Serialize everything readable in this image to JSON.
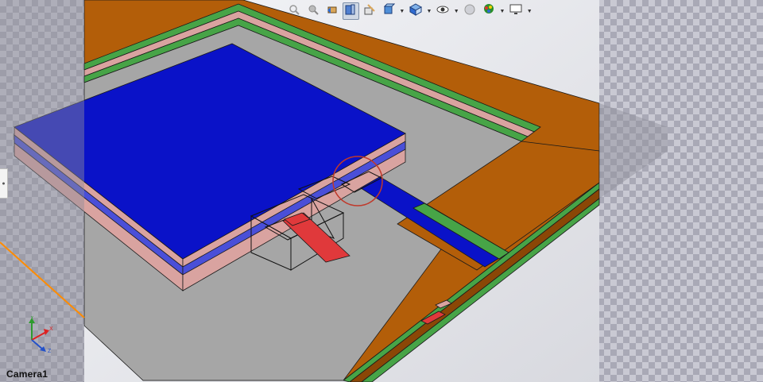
{
  "viewport": {
    "camera_label": "Camera1",
    "colors": {
      "board": "#b35e09",
      "board_edge": "#8a4706",
      "cavity_floor": "#a6a6a6",
      "blue": "#0a12c8",
      "blue_side": "#4a4fd8",
      "green": "#47a447",
      "pink": "#d9a3a0",
      "red": "#e0393b",
      "light_bg": "#e9eaee"
    }
  },
  "toolbar": {
    "items": [
      {
        "name": "zoom-to-fit-icon",
        "active": false
      },
      {
        "name": "zoom-to-area-icon",
        "active": false
      },
      {
        "name": "previous-view-icon",
        "active": false
      },
      {
        "name": "section-view-icon",
        "active": true
      },
      {
        "name": "dynamic-annotation-icon",
        "active": false
      },
      {
        "name": "view-orientation-icon",
        "active": false,
        "dropdown": true
      },
      {
        "name": "display-style-icon",
        "active": false,
        "dropdown": true
      },
      {
        "name": "hide-show-items-icon",
        "active": false,
        "dropdown": true
      },
      {
        "name": "edit-appearance-icon",
        "active": false
      },
      {
        "name": "apply-scene-icon",
        "active": false,
        "dropdown": true
      },
      {
        "name": "view-settings-icon",
        "active": false,
        "dropdown": true
      }
    ]
  },
  "triad": {
    "x_label": "X",
    "y_label": "Y",
    "z_label": "Z"
  }
}
